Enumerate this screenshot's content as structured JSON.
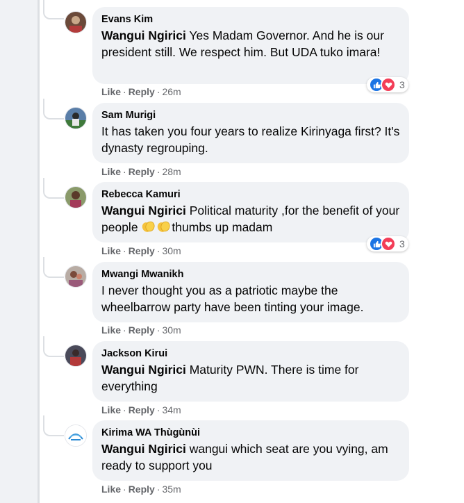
{
  "actions": {
    "like": "Like",
    "reply": "Reply",
    "sep": "·"
  },
  "comments": [
    {
      "author": "Evans Kim",
      "mention": "Wangui Ngirici",
      "text": " Yes Madam Governor. And he is our president still. We respect him. But UDA tuko imara!",
      "time": "26m",
      "reaction_count": "3",
      "avatar_icon": "person-photo-icon"
    },
    {
      "author": "Sam Murigi",
      "mention": "",
      "text": "It has taken you four years to realize Kirinyaga first? It's dynasty regrouping.",
      "time": "28m",
      "reaction_count": "",
      "avatar_icon": "person-photo-icon"
    },
    {
      "author": "Rebecca Kamuri",
      "mention": "Wangui Ngirici",
      "text": " Political maturity ,for the benefit of your people ",
      "text2": "thumbs up madam",
      "time": "30m",
      "reaction_count": "3",
      "avatar_icon": "person-photo-icon"
    },
    {
      "author": "Mwangi Mwanikh",
      "mention": "",
      "text": "I never thought you as a patriotic maybe the wheelbarrow party have been tinting your image.",
      "time": "30m",
      "reaction_count": "",
      "avatar_icon": "person-photo-icon"
    },
    {
      "author": "Jackson Kirui",
      "mention": "Wangui Ngirici",
      "text": " Maturity PWN. There is time for everything",
      "time": "34m",
      "reaction_count": "",
      "avatar_icon": "person-photo-icon"
    },
    {
      "author": "Kirima WA Thùgùnùi",
      "mention": "Wangui Ngirici",
      "text": " wangui which seat are you vying, am ready to support you",
      "time": "35m",
      "reaction_count": "",
      "avatar_icon": "logo-avatar-icon"
    }
  ],
  "colors": {
    "like_blue": "#1b74e4",
    "love_red": "#f33e58",
    "bubble_bg": "#f0f2f5",
    "meta_gray": "#65676b"
  }
}
